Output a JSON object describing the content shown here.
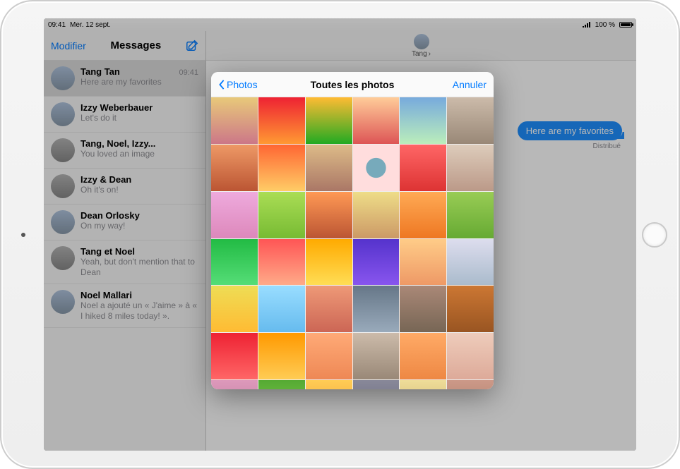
{
  "statusbar": {
    "time": "09:41",
    "date": "Mer. 12 sept.",
    "battery_pct": "100 %"
  },
  "sidebar": {
    "edit_label": "Modifier",
    "title": "Messages"
  },
  "conversations": [
    {
      "name": "Tang Tan",
      "preview": "Here are my favorites",
      "time": "09:41"
    },
    {
      "name": "Izzy Weberbauer",
      "preview": "Let's do it",
      "time": ""
    },
    {
      "name": "Tang, Noel, Izzy...",
      "preview": "You loved an image",
      "time": ""
    },
    {
      "name": "Izzy & Dean",
      "preview": "Oh it's on!",
      "time": ""
    },
    {
      "name": "Dean Orlosky",
      "preview": "On my way!",
      "time": ""
    },
    {
      "name": "Tang et Noel",
      "preview": "Yeah, but don't mention that to Dean",
      "time": ""
    },
    {
      "name": "Noel Mallari",
      "preview": "Noel a ajouté un « J'aime » à « I hiked 8 miles today! ».",
      "time": ""
    }
  ],
  "chat": {
    "recipient": "Tang",
    "bubble_text": "Here are my favorites",
    "delivered_label": "Distribué"
  },
  "picker": {
    "back_label": "Photos",
    "title": "Toutes les photos",
    "cancel_label": "Annuler",
    "thumb_count": 42
  }
}
